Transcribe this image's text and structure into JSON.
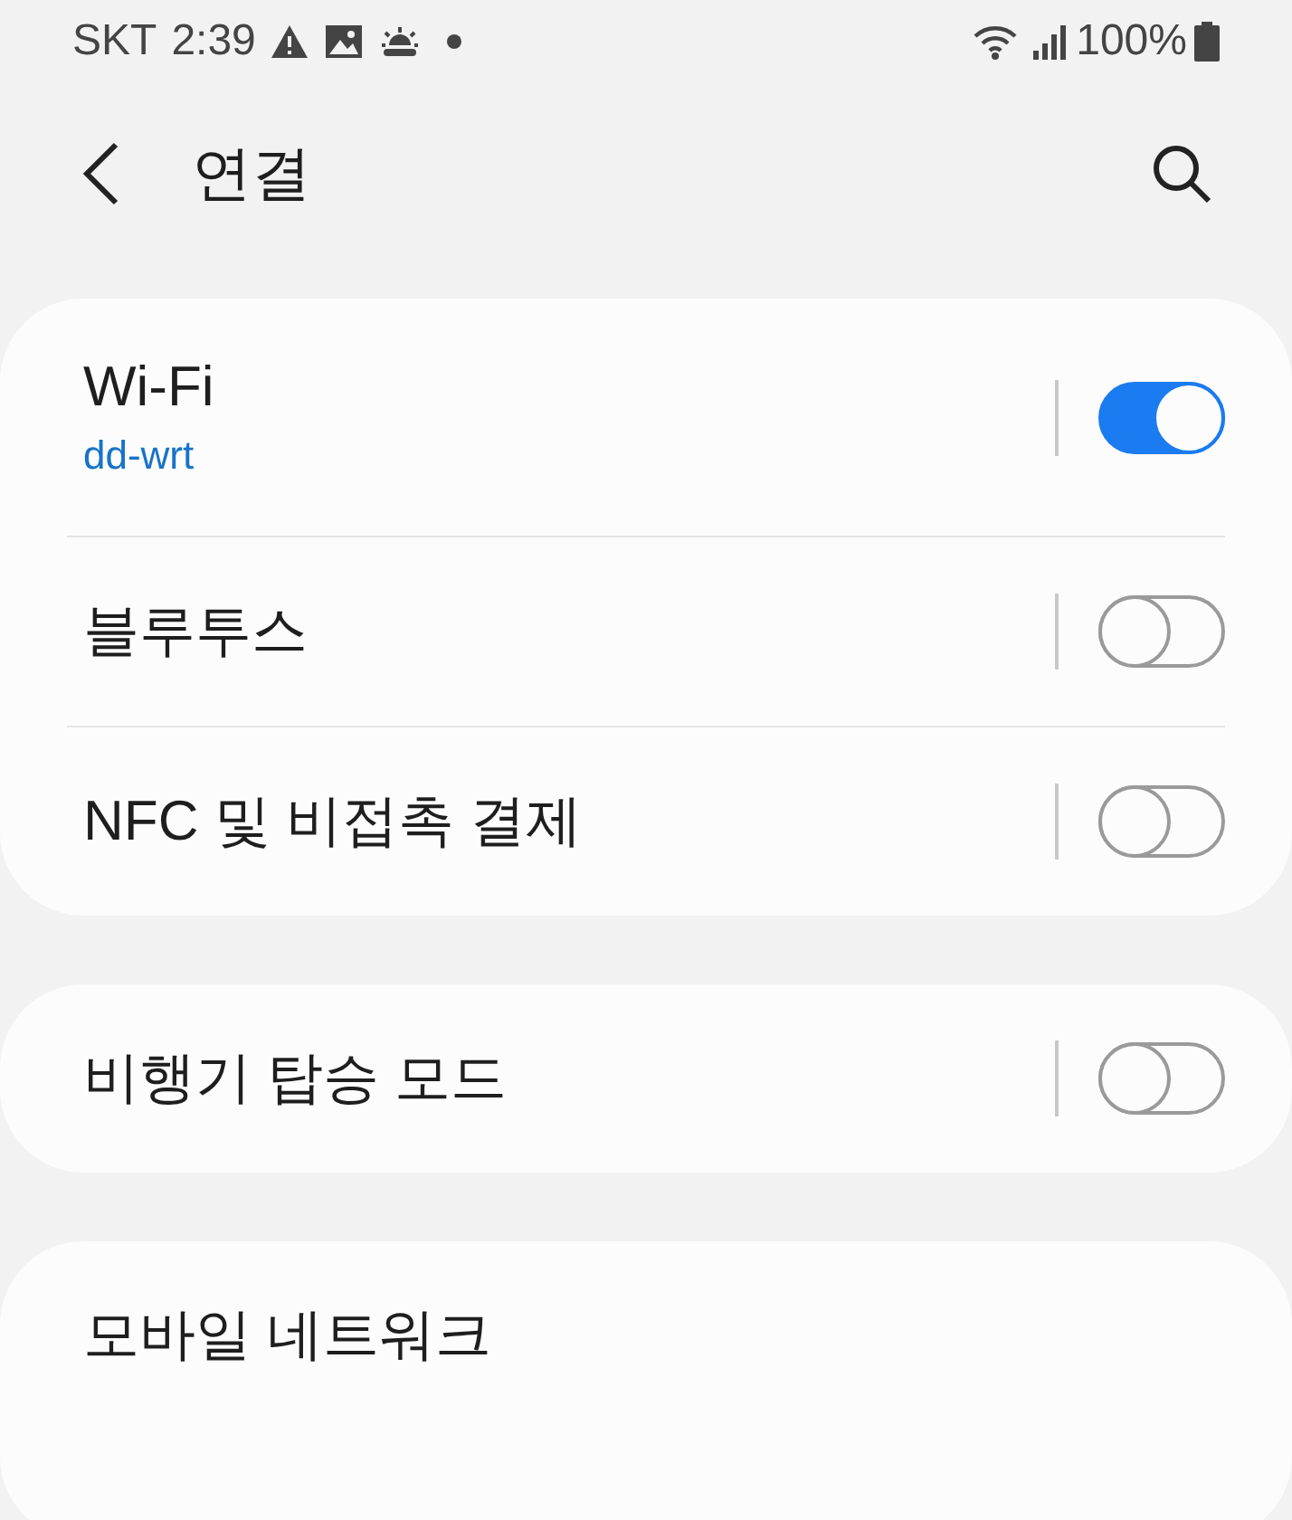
{
  "status_bar": {
    "carrier": "SKT",
    "time": "2:39",
    "battery": "100%"
  },
  "header": {
    "title": "연결"
  },
  "groups": [
    {
      "items": [
        {
          "kind": "toggle",
          "title": "Wi-Fi",
          "subtitle": "dd-wrt",
          "on": true
        },
        {
          "kind": "toggle",
          "title": "블루투스",
          "on": false
        },
        {
          "kind": "toggle",
          "title": "NFC 및 비접촉 결제",
          "on": false
        }
      ]
    },
    {
      "items": [
        {
          "kind": "toggle",
          "title": "비행기 탑승 모드",
          "on": false
        }
      ]
    },
    {
      "items": [
        {
          "kind": "link",
          "title": "모바일 네트워크"
        }
      ]
    }
  ]
}
